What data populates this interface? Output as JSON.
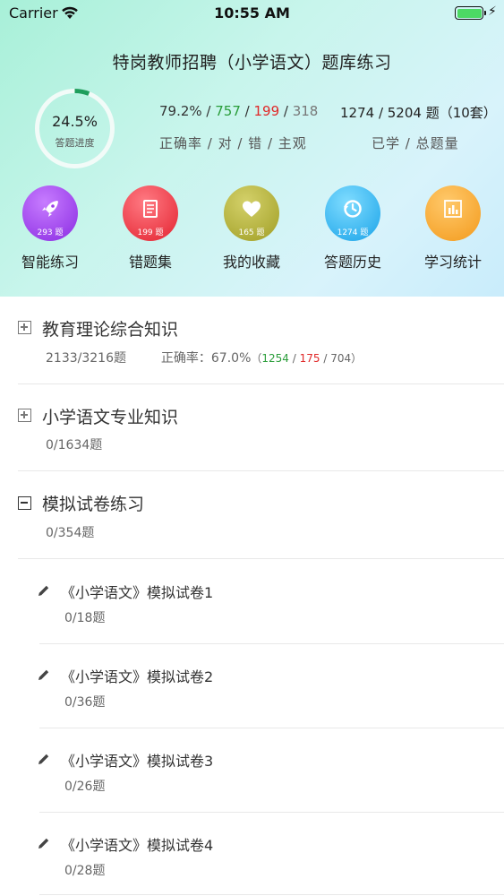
{
  "status_bar": {
    "carrier": "Carrier",
    "time": "10:55 AM"
  },
  "header": {
    "title": "特岗教师招聘（小学语文）题库练习"
  },
  "progress": {
    "percent": "24.5%",
    "label": "答题进度",
    "fraction": 0.245,
    "ring_color": "#1e9e5c"
  },
  "stats": {
    "rate": "79.2%",
    "sep": " / ",
    "correct": "757",
    "wrong": "199",
    "subjective": "318",
    "caption": "正确率 / 对 / 错 / 主观",
    "total": "1274 / 5204 题（10套）",
    "total_caption": "已学 / 总题量"
  },
  "shortcuts": [
    {
      "label": "智能练习",
      "count": "293 题",
      "icon": "rocket-icon",
      "color": "#9b3fe8"
    },
    {
      "label": "错题集",
      "count": "199 题",
      "icon": "document-icon",
      "color": "#ef3b47"
    },
    {
      "label": "我的收藏",
      "count": "165 题",
      "icon": "heart-icon",
      "color": "#b2b038"
    },
    {
      "label": "答题历史",
      "count": "1274 题",
      "icon": "history-icon",
      "color": "#28b3ee"
    },
    {
      "label": "学习统计",
      "count": "",
      "icon": "bar-chart-icon",
      "color": "#f5a623"
    }
  ],
  "sections": [
    {
      "title": "教育理论综合知识",
      "progress": "2133/3216题",
      "rate_label": "正确率：",
      "rate": "67.0%",
      "open": "（",
      "correct": "1254",
      "sep": " / ",
      "wrong": "175",
      "subjective": "704",
      "close": "）"
    },
    {
      "title": "小学语文专业知识",
      "progress": "0/1634题"
    },
    {
      "title": "模拟试卷练习",
      "progress": "0/354题"
    }
  ],
  "papers": [
    {
      "title": "《小学语文》模拟试卷1",
      "progress": "0/18题"
    },
    {
      "title": "《小学语文》模拟试卷2",
      "progress": "0/36题"
    },
    {
      "title": "《小学语文》模拟试卷3",
      "progress": "0/26题"
    },
    {
      "title": "《小学语文》模拟试卷4",
      "progress": "0/28题"
    }
  ]
}
